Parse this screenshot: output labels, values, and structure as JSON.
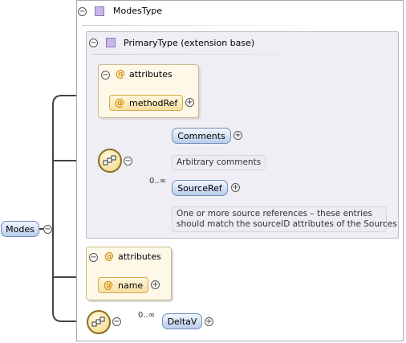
{
  "root": {
    "label": "Modes"
  },
  "modes_type": {
    "label": "ModesType"
  },
  "primary_type": {
    "label": "PrimaryType (extension base)"
  },
  "extension_attributes": {
    "header": "attributes",
    "method_ref": "methodRef"
  },
  "sequence": {
    "comments": {
      "label": "Comments",
      "doc": "Arbitrary comments"
    },
    "source_ref": {
      "label": "SourceRef",
      "occurrence": "0..∞",
      "doc_line1": "One or more source references – these entries",
      "doc_line2": "should match the sourceID attributes of the Sources"
    }
  },
  "own_attributes": {
    "header": "attributes",
    "name": "name"
  },
  "delta_v": {
    "label": "DeltaV",
    "occurrence": "0..∞"
  },
  "symbols": {
    "collapse": "−",
    "expand": "+",
    "attribute": "@"
  },
  "colors": {
    "element_fill": "#b9cdea",
    "attribute_fill": "#f7dfa3",
    "type_icon": "#c9b8e6",
    "extension_fill": "#eeeef4"
  }
}
